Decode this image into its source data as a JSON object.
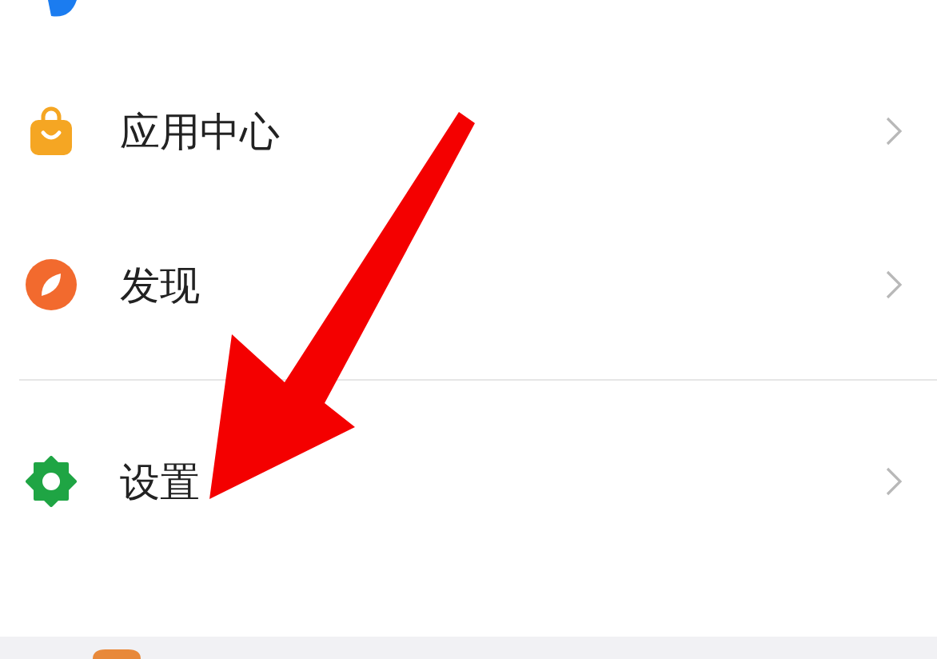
{
  "menu": [
    {
      "kind": "bag",
      "label": "应用中心"
    },
    {
      "kind": "compass",
      "label": "发现"
    },
    {
      "kind": "divider"
    },
    {
      "kind": "gear",
      "label": "设置"
    }
  ]
}
